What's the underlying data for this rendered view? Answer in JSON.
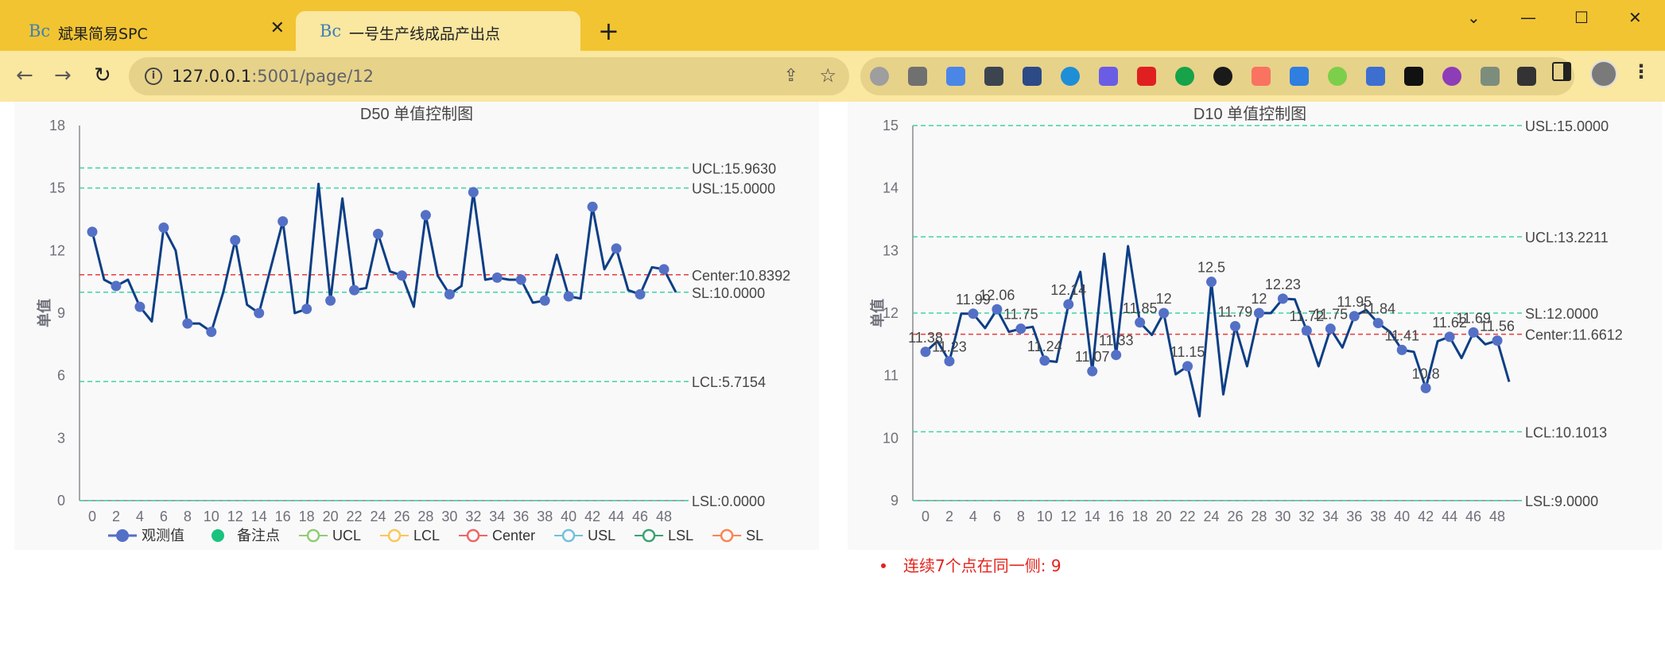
{
  "browser": {
    "tabs": [
      {
        "favicon": "Bc",
        "title": "斌果简易SPC",
        "active": false
      },
      {
        "favicon": "Bc",
        "title": "一号生产线成品产出点",
        "active": true
      }
    ],
    "new_tab": "+",
    "window_controls": {
      "minimize": "—",
      "restore": "☐",
      "close": "✕"
    },
    "url_host": "127.0.0.1",
    "url_path": ":5001/page/12",
    "extensions": [
      "record-icon",
      "download-icon",
      "translate-icon",
      "dots-icon",
      "pdf-icon",
      "edge-icon",
      "check-icon",
      "shield-icon",
      "wechat-icon",
      "block-icon",
      "flower-icon",
      "link-icon",
      "js-icon",
      "text-icon",
      "tab-icon",
      "history-icon",
      "v-icon",
      "puzzle-icon"
    ]
  },
  "legend": [
    "观测值",
    "备注点",
    "UCL",
    "LCL",
    "Center",
    "USL",
    "LSL",
    "SL"
  ],
  "legend_colors": [
    "#5470c6",
    "#19c37d",
    "#91cc75",
    "#fac858",
    "#ee6666",
    "#73c0de",
    "#3ba272",
    "#fc8452"
  ],
  "warning": "连续7个点在同一侧: 9",
  "chart_data": [
    {
      "type": "line",
      "title": "D50 单值控制图",
      "ylabel": "单值",
      "ylim": [
        0,
        18
      ],
      "yticks": [
        0,
        3,
        6,
        9,
        12,
        15,
        18
      ],
      "xticks": [
        0,
        2,
        4,
        6,
        8,
        10,
        12,
        14,
        16,
        18,
        20,
        22,
        24,
        26,
        28,
        30,
        32,
        34,
        36,
        38,
        40,
        42,
        44,
        46,
        48
      ],
      "limits": [
        {
          "name": "UCL",
          "value": 15.963,
          "label": "UCL:15.9630",
          "color": "#3ed4a6"
        },
        {
          "name": "USL",
          "value": 15.0,
          "label": "USL:15.0000",
          "color": "#3ed4a6"
        },
        {
          "name": "Center",
          "value": 10.8392,
          "label": "Center:10.8392",
          "color": "#e83c3c"
        },
        {
          "name": "SL",
          "value": 10.0,
          "label": "SL:10.0000",
          "color": "#3ed4a6"
        },
        {
          "name": "LCL",
          "value": 5.7154,
          "label": "LCL:5.7154",
          "color": "#3ed4a6"
        },
        {
          "name": "LSL",
          "value": 0.0,
          "label": "LSL:0.0000",
          "color": "#3ed4a6"
        }
      ],
      "values": [
        12.9,
        10.6,
        10.3,
        10.6,
        9.3,
        8.6,
        13.1,
        12.0,
        8.5,
        8.5,
        8.1,
        10.0,
        12.5,
        9.4,
        9.0,
        11.2,
        13.4,
        9.0,
        9.2,
        15.2,
        9.6,
        14.5,
        10.1,
        10.2,
        12.8,
        11.0,
        10.8,
        9.3,
        13.7,
        10.8,
        9.9,
        10.3,
        14.8,
        10.6,
        10.7,
        10.6,
        10.6,
        9.5,
        9.6,
        11.8,
        9.8,
        9.7,
        14.1,
        11.1,
        12.1,
        10.1,
        9.9,
        11.2,
        11.1,
        10.0
      ],
      "markers": [
        0,
        2,
        4,
        6,
        8,
        10,
        12,
        14,
        16,
        18,
        20,
        22,
        24,
        26,
        28,
        30,
        32,
        34,
        36,
        38,
        40,
        42,
        44,
        46,
        48
      ],
      "point_labels": []
    },
    {
      "type": "line",
      "title": "D10 单值控制图",
      "ylabel": "单值",
      "ylim": [
        9,
        15
      ],
      "yticks": [
        9,
        10,
        11,
        12,
        13,
        14,
        15
      ],
      "xticks": [
        0,
        2,
        4,
        6,
        8,
        10,
        12,
        14,
        16,
        18,
        20,
        22,
        24,
        26,
        28,
        30,
        32,
        34,
        36,
        38,
        40,
        42,
        44,
        46,
        48
      ],
      "limits": [
        {
          "name": "USL",
          "value": 15.0,
          "label": "USL:15.0000",
          "color": "#3ed4a6"
        },
        {
          "name": "UCL",
          "value": 13.2211,
          "label": "UCL:13.2211",
          "color": "#3ed4a6"
        },
        {
          "name": "SL",
          "value": 12.0,
          "label": "SL:12.0000",
          "color": "#3ed4a6"
        },
        {
          "name": "Center",
          "value": 11.6612,
          "label": "Center:11.6612",
          "color": "#e83c3c"
        },
        {
          "name": "LCL",
          "value": 10.1013,
          "label": "LCL:10.1013",
          "color": "#3ed4a6"
        },
        {
          "name": "LSL",
          "value": 9.0,
          "label": "LSL:9.0000",
          "color": "#3ed4a6"
        }
      ],
      "values": [
        11.38,
        11.55,
        11.23,
        11.99,
        11.99,
        11.76,
        12.06,
        11.7,
        11.75,
        11.78,
        11.24,
        11.22,
        12.14,
        12.66,
        11.07,
        12.95,
        11.33,
        13.07,
        11.85,
        11.65,
        12.0,
        11.02,
        11.15,
        10.35,
        12.5,
        10.7,
        11.79,
        11.15,
        12.0,
        12.0,
        12.23,
        12.22,
        11.72,
        11.15,
        11.75,
        11.45,
        11.95,
        12.05,
        11.84,
        11.7,
        11.41,
        11.38,
        10.8,
        11.55,
        11.62,
        11.28,
        11.69,
        11.5,
        11.56,
        10.9
      ],
      "markers": [
        0,
        2,
        4,
        6,
        8,
        10,
        12,
        14,
        16,
        18,
        20,
        22,
        24,
        26,
        28,
        30,
        32,
        34,
        36,
        38,
        40,
        42,
        44,
        46,
        48
      ],
      "point_labels": [
        {
          "i": 0,
          "text": "11.38"
        },
        {
          "i": 2,
          "text": "11.23"
        },
        {
          "i": 4,
          "text": "11.99"
        },
        {
          "i": 6,
          "text": "12.06"
        },
        {
          "i": 8,
          "text": "11.75"
        },
        {
          "i": 10,
          "text": "11.24"
        },
        {
          "i": 12,
          "text": "12.14"
        },
        {
          "i": 14,
          "text": "11.07"
        },
        {
          "i": 16,
          "text": "11.33"
        },
        {
          "i": 18,
          "text": "11.85"
        },
        {
          "i": 20,
          "text": "12"
        },
        {
          "i": 22,
          "text": "11.15"
        },
        {
          "i": 24,
          "text": "12.5"
        },
        {
          "i": 26,
          "text": "11.79"
        },
        {
          "i": 28,
          "text": "12"
        },
        {
          "i": 30,
          "text": "12.23"
        },
        {
          "i": 32,
          "text": "11.72"
        },
        {
          "i": 34,
          "text": "11.75"
        },
        {
          "i": 36,
          "text": "11.95"
        },
        {
          "i": 38,
          "text": "11.84"
        },
        {
          "i": 40,
          "text": "11.41"
        },
        {
          "i": 42,
          "text": "10.8"
        },
        {
          "i": 44,
          "text": "11.62"
        },
        {
          "i": 46,
          "text": "11.69"
        },
        {
          "i": 48,
          "text": "11.56"
        }
      ]
    }
  ]
}
